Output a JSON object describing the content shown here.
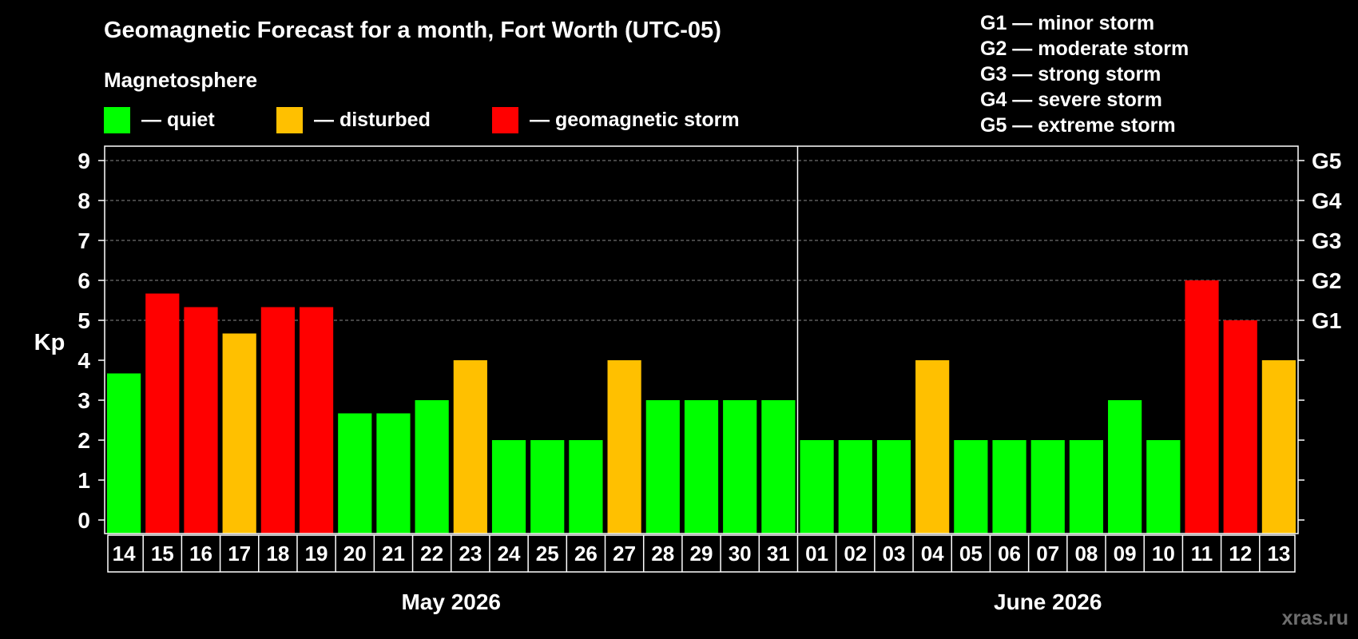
{
  "header": {
    "title": "Geomagnetic Forecast for a month, Fort Worth (UTC-05)",
    "legend_heading": "Magnetosphere",
    "watermark": "xras.ru"
  },
  "legend": [
    {
      "label": "— quiet",
      "color": "#00ff00"
    },
    {
      "label": "— disturbed",
      "color": "#ffc000"
    },
    {
      "label": "— geomagnetic storm",
      "color": "#ff0000"
    }
  ],
  "storm_scale": [
    "G1 — minor storm",
    "G2 — moderate storm",
    "G3 — strong storm",
    "G4 — severe storm",
    "G5 — extreme storm"
  ],
  "chart_data": {
    "type": "bar",
    "title": "Geomagnetic Forecast for a month, Fort Worth (UTC-05)",
    "ylabel": "Kp",
    "ylim": [
      0,
      9
    ],
    "yticks": [
      "0",
      "1",
      "2",
      "3",
      "4",
      "5",
      "6",
      "7",
      "8",
      "9"
    ],
    "right_axis_labels": [
      {
        "kp": 5,
        "label": "G1"
      },
      {
        "kp": 6,
        "label": "G2"
      },
      {
        "kp": 7,
        "label": "G3"
      },
      {
        "kp": 8,
        "label": "G4"
      },
      {
        "kp": 9,
        "label": "G5"
      }
    ],
    "grid": "horizontal dashed at Kp 5–9",
    "categories": [
      "14",
      "15",
      "16",
      "17",
      "18",
      "19",
      "20",
      "21",
      "22",
      "23",
      "24",
      "25",
      "26",
      "27",
      "28",
      "29",
      "30",
      "31",
      "01",
      "02",
      "03",
      "04",
      "05",
      "06",
      "07",
      "08",
      "09",
      "10",
      "11",
      "12",
      "13"
    ],
    "values": [
      3.67,
      5.67,
      5.33,
      4.67,
      5.33,
      5.33,
      2.67,
      2.67,
      3,
      4,
      2,
      2,
      2,
      4,
      3,
      3,
      3,
      3,
      2,
      2,
      2,
      4,
      2,
      2,
      2,
      2,
      3,
      2,
      6,
      5,
      4
    ],
    "status": [
      "quiet",
      "storm",
      "storm",
      "disturbed",
      "storm",
      "storm",
      "quiet",
      "quiet",
      "quiet",
      "disturbed",
      "quiet",
      "quiet",
      "quiet",
      "disturbed",
      "quiet",
      "quiet",
      "quiet",
      "quiet",
      "quiet",
      "quiet",
      "quiet",
      "disturbed",
      "quiet",
      "quiet",
      "quiet",
      "quiet",
      "quiet",
      "quiet",
      "storm",
      "storm",
      "disturbed"
    ],
    "status_colors": {
      "quiet": "#00ff00",
      "disturbed": "#ffc000",
      "storm": "#ff0000"
    },
    "months": [
      {
        "label": "May 2026",
        "days": 18
      },
      {
        "label": "June 2026",
        "days": 13
      }
    ]
  }
}
